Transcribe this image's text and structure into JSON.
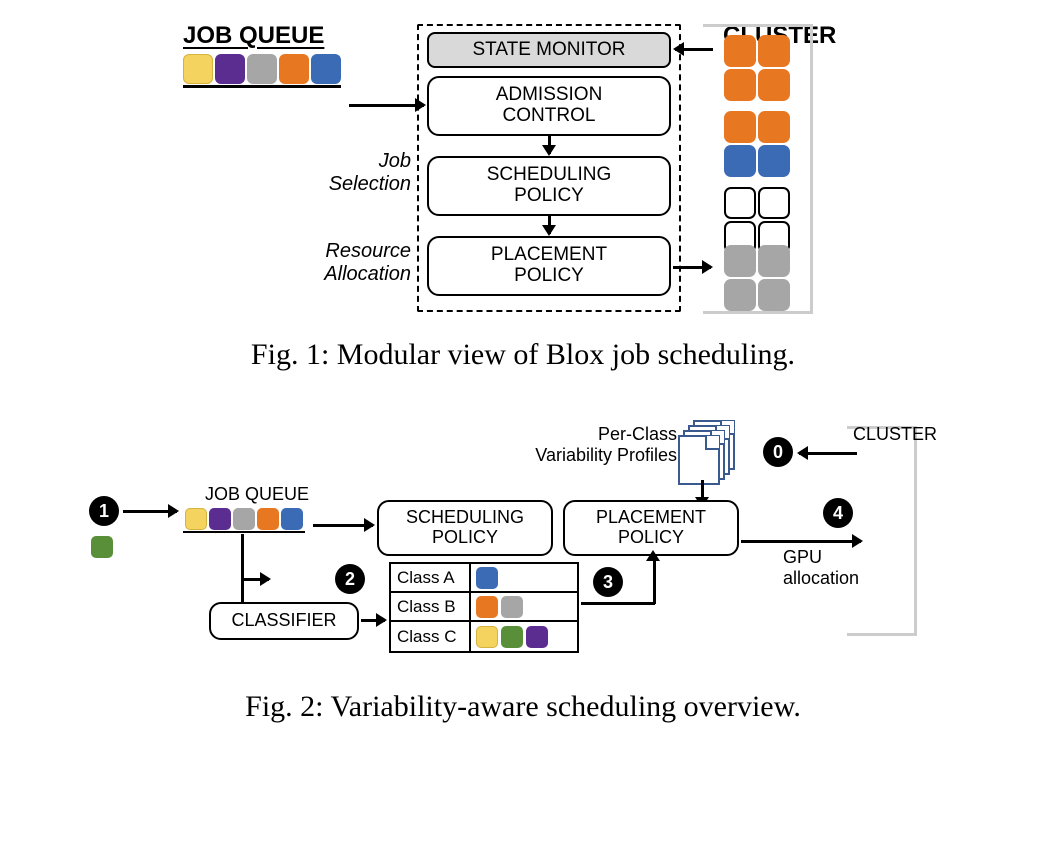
{
  "fig1": {
    "jobQueueTitle": "JOB QUEUE",
    "clusterTitle": "CLUSTER",
    "modules": {
      "stateMonitor": "STATE MONITOR",
      "admission": "ADMISSION\nCONTROL",
      "scheduling": "SCHEDULING\nPOLICY",
      "placement": "PLACEMENT\nPOLICY"
    },
    "sideLabels": {
      "jobSelection": "Job\nSelection",
      "resourceAllocation": "Resource\nAllocation"
    },
    "queueColors": [
      "yellow",
      "purple",
      "gray",
      "orange",
      "blue"
    ],
    "clusterGroups": [
      [
        "orange",
        "orange",
        "orange",
        "orange"
      ],
      [
        "orange",
        "orange",
        "blue",
        "blue"
      ],
      [
        "white",
        "white",
        "white",
        "white"
      ],
      [
        "gray",
        "gray",
        "gray",
        "gray"
      ]
    ],
    "caption": "Fig. 1: Modular view of Blox job scheduling."
  },
  "fig2": {
    "jobQueueTitle": "JOB QUEUE",
    "clusterTitle": "CLUSTER",
    "perClassLabel": "Per-Class\nVariability Profiles",
    "modules": {
      "scheduling": "SCHEDULING\nPOLICY",
      "placement": "PLACEMENT\nPOLICY",
      "classifier": "CLASSIFIER"
    },
    "gpuAllocation": "GPU\nallocation",
    "queueColors": [
      "yellow",
      "purple",
      "gray",
      "orange",
      "blue"
    ],
    "incomingColor": "green",
    "classTable": [
      {
        "name": "Class A",
        "chips": [
          "blue"
        ]
      },
      {
        "name": "Class B",
        "chips": [
          "orange",
          "gray"
        ]
      },
      {
        "name": "Class C",
        "chips": [
          "yellow",
          "green",
          "purple"
        ]
      }
    ],
    "badges": [
      "0",
      "1",
      "2",
      "3",
      "4"
    ],
    "caption": "Fig. 2: Variability-aware scheduling overview."
  }
}
